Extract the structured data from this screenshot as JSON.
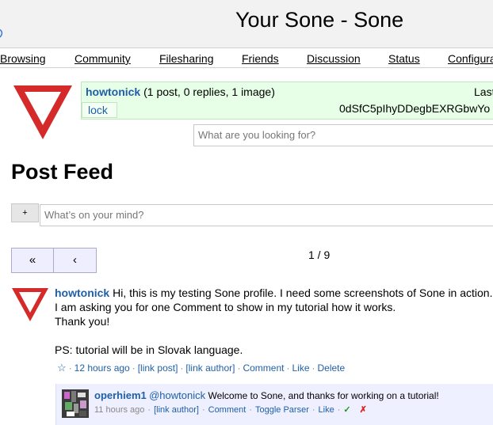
{
  "header": {
    "title": "Your Sone - Sone"
  },
  "nav": {
    "items": [
      "Browsing",
      "Community",
      "Filesharing",
      "Friends",
      "Discussion",
      "Status",
      "Configuration"
    ]
  },
  "profile": {
    "name": "howtonick",
    "stats": "(1 post, 0 replies, 1 image)",
    "last_label": "Last",
    "lock_label": "lock",
    "sone_id": "0dSfC5pIhyDDegbEXRGbwYo"
  },
  "search": {
    "placeholder": "What are you looking for?"
  },
  "feed": {
    "title": "Post Feed",
    "plus_label": "+",
    "post_placeholder": "What’s on your mind?"
  },
  "pagination": {
    "first_label": "«",
    "prev_label": "‹",
    "count": "1 / 9"
  },
  "post": {
    "author": "howtonick",
    "line1": "Hi, this is my testing Sone profile. I need some screenshots of Sone in action.",
    "line2": "I am asking you for one Comment to show in my tutorial how it works.",
    "line3": "Thank you!",
    "line5": "PS: tutorial will be in Slovak language.",
    "star_icon": "☆",
    "time": "12 hours ago",
    "link_post": "[link post]",
    "link_author": "[link author]",
    "comment": "Comment",
    "like": "Like",
    "delete": "Delete"
  },
  "reply": {
    "author": "operhiem1",
    "mention": "@howtonick",
    "text": "Welcome to Sone, and thanks for working on a tutorial!",
    "time": "11 hours ago",
    "link_author": "[link author]",
    "comment": "Comment",
    "toggle_parser": "Toggle Parser",
    "like": "Like",
    "trust_icon": "✓",
    "distrust_icon": "✗"
  },
  "colors": {
    "link": "#1f5fa8",
    "profile_bg": "#e6ffe6",
    "reply_bg": "#eef0ff",
    "trust": "#1a9a1a",
    "distrust": "#dd2222",
    "avatar_red": "#d42a2a"
  }
}
